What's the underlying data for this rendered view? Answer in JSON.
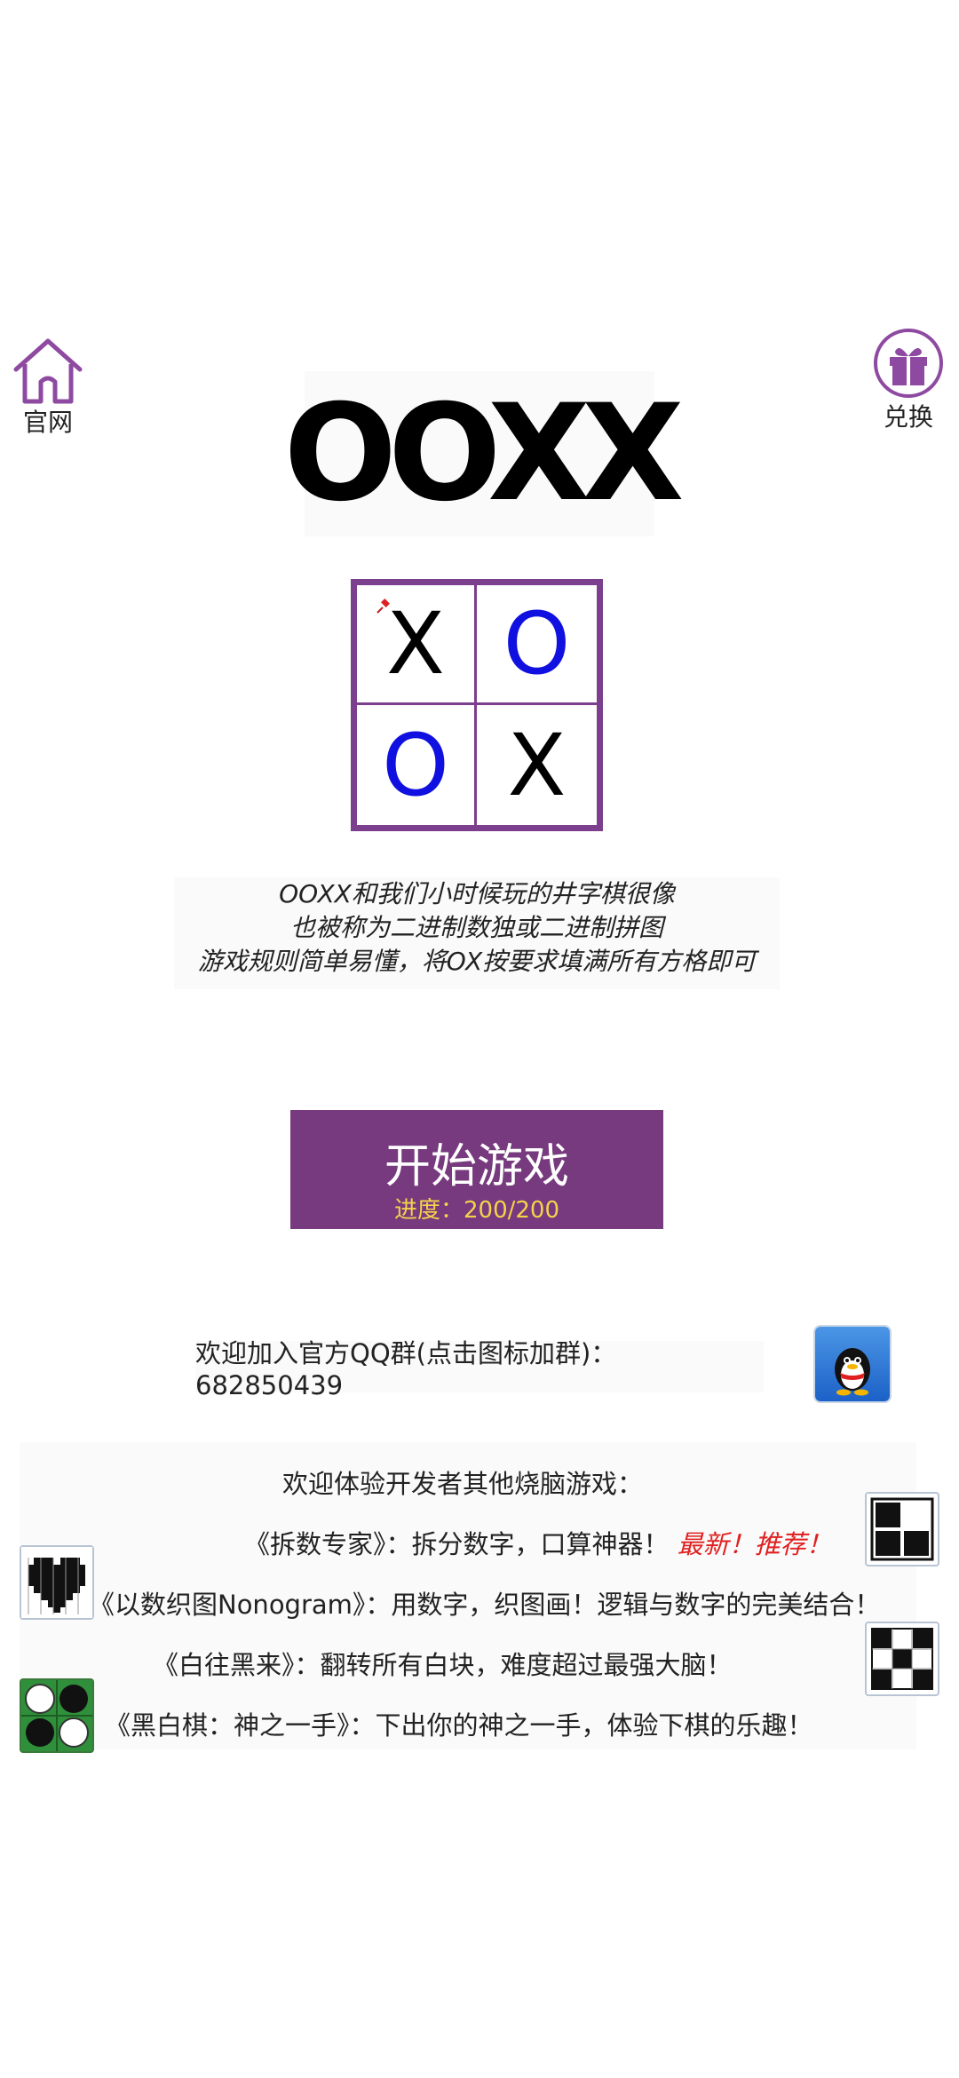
{
  "header": {
    "home_label": "官网",
    "redeem_label": "兑换",
    "home_icon": "home-icon",
    "redeem_icon": "gift-icon",
    "accent_color": "#8e4aa1"
  },
  "title": "OOXX",
  "board": {
    "cells": [
      "X",
      "O",
      "O",
      "X"
    ],
    "border_color": "#7b3f8e",
    "x_color": "#000000",
    "o_color": "#1010e0"
  },
  "description": {
    "line1": "OOXX和我们小时候玩的井字棋很像",
    "line2": "也被称为二进制数独或二进制拼图",
    "line3": "游戏规则简单易懂，将OX按要求填满所有方格即可"
  },
  "start_button": {
    "label": "开始游戏",
    "progress": "进度：200/200",
    "bg_color": "#773a7e",
    "progress_color": "#f6d24a"
  },
  "qq": {
    "text": "欢迎加入官方QQ群(点击图标加群)：682850439",
    "icon": "qq-penguin-icon"
  },
  "other_games": {
    "heading": "欢迎体验开发者其他烧脑游戏：",
    "games": [
      {
        "text": "《拆数专家》：拆分数字，口算神器！",
        "tag": "最新！推荐！",
        "icon": "chaishu-game-icon"
      },
      {
        "text": "《以数织图Nonogram》：用数字，织图画！逻辑与数字的完美结合！",
        "tag": "",
        "icon": "nonogram-heart-icon"
      },
      {
        "text": "《白往黑来》：翻转所有白块，难度超过最强大脑！",
        "tag": "",
        "icon": "flip-blocks-icon"
      },
      {
        "text": "《黑白棋：神之一手》：下出你的神之一手，体验下棋的乐趣！",
        "tag": "",
        "icon": "othello-icon"
      }
    ]
  }
}
